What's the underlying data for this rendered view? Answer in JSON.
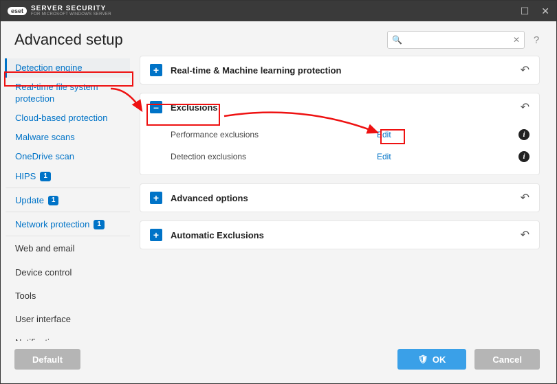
{
  "titlebar": {
    "brand_short": "eset",
    "brand_line1": "SERVER SECURITY",
    "brand_line2": "FOR MICROSOFT WINDOWS SERVER"
  },
  "page_title": "Advanced setup",
  "search": {
    "placeholder": ""
  },
  "sidebar": {
    "items": [
      {
        "label": "Detection engine",
        "selected": true
      },
      {
        "label": "Real-time file system protection"
      },
      {
        "label": "Cloud-based protection"
      },
      {
        "label": "Malware scans"
      },
      {
        "label": "OneDrive scan"
      },
      {
        "label": "HIPS",
        "badge": "1"
      },
      {
        "label": "Update",
        "badge": "1",
        "divider": true
      },
      {
        "label": "Network protection",
        "badge": "1",
        "divider": true
      },
      {
        "label": "Web and email",
        "black": true,
        "divider": true
      },
      {
        "label": "Device control",
        "black": true
      },
      {
        "label": "Tools",
        "black": true
      },
      {
        "label": "User interface",
        "black": true
      },
      {
        "label": "Notifications",
        "black": true
      }
    ]
  },
  "panels": [
    {
      "key": "realtime_ml",
      "title": "Real-time & Machine learning protection",
      "expanded": false
    },
    {
      "key": "exclusions",
      "title": "Exclusions",
      "expanded": true,
      "rows": [
        {
          "label": "Performance exclusions",
          "action": "Edit"
        },
        {
          "label": "Detection exclusions",
          "action": "Edit"
        }
      ]
    },
    {
      "key": "advanced",
      "title": "Advanced options",
      "expanded": false
    },
    {
      "key": "auto_excl",
      "title": "Automatic Exclusions",
      "expanded": false
    }
  ],
  "footer": {
    "default_label": "Default",
    "ok_label": "OK",
    "cancel_label": "Cancel"
  }
}
